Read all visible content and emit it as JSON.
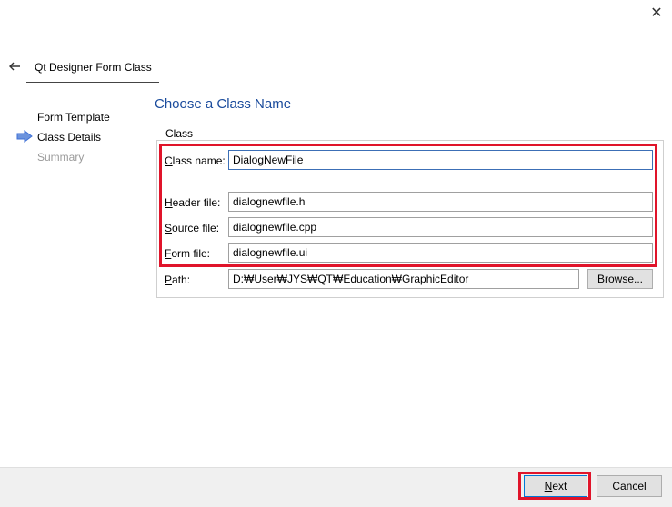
{
  "window": {
    "close_label": "✕"
  },
  "wizard": {
    "title": "Qt Designer Form Class"
  },
  "steps": [
    {
      "label": "Form Template",
      "state": "done"
    },
    {
      "label": "Class Details",
      "state": "current"
    },
    {
      "label": "Summary",
      "state": "pending"
    }
  ],
  "page": {
    "heading": "Choose a Class Name"
  },
  "class_group": {
    "legend": "Class",
    "class_name": {
      "label_key": "C",
      "label_rest": "lass name:",
      "value": "DialogNewFile"
    },
    "header_file": {
      "label_key": "H",
      "label_rest": "eader file:",
      "value": "dialognewfile.h"
    },
    "source_file": {
      "label_key": "S",
      "label_rest": "ource file:",
      "value": "dialognewfile.cpp"
    },
    "form_file": {
      "label_key": "F",
      "label_rest": "orm file:",
      "value": "dialognewfile.ui"
    }
  },
  "path": {
    "label_key": "P",
    "label_rest": "ath:",
    "value": "D:₩User₩JYS₩QT₩Education₩GraphicEditor",
    "browse_label": "Browse..."
  },
  "footer": {
    "next_key": "N",
    "next_rest": "ext",
    "cancel_label": "Cancel"
  },
  "colors": {
    "highlight": "#e0142a",
    "heading": "#1a4b9c",
    "step_arrow": "#3d6fd6",
    "disabled_text": "#9a9a9a"
  }
}
